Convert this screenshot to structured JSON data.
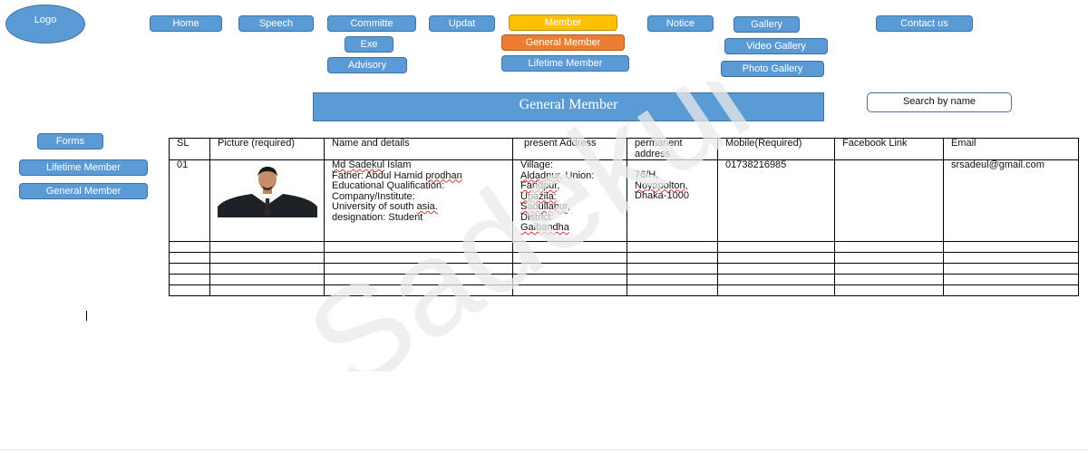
{
  "logo": "Logo",
  "nav": {
    "home": "Home",
    "speech": "Speech",
    "committee": "Committe",
    "exe": "Exe",
    "advisory": "Advisory",
    "update": "Updat",
    "member": "Member",
    "general_member": "General Member",
    "lifetime_member": "Lifetime Member",
    "notice": "Notice",
    "gallery": "Gallery",
    "video_gallery": "Video Gallery",
    "photo_gallery": "Photo Gallery",
    "contact": "Contact us"
  },
  "page_title": "General Member",
  "search": {
    "label": "Search by name"
  },
  "sidebar": {
    "forms": "Forms",
    "lifetime_member": "Lifetime Member",
    "general_member": "General Member"
  },
  "table": {
    "headers": {
      "sl": "SL",
      "picture": "Picture (required)",
      "name": "Name and details",
      "present": "present Address",
      "permanent": "permanent address",
      "mobile": "Mobile(Required)",
      "facebook": "Facebook Link",
      "email": "Email"
    },
    "row1": {
      "sl": "01",
      "name_line1": "Md Sadekul Islam",
      "name_line2": "Father: Abdul Hamid prodhan",
      "name_line3": "Educational Qualification:",
      "name_line4": "Company/Institute:",
      "name_line5": "University of south asia.",
      "name_line6": "designation: Student",
      "present_line1": "Village:",
      "present_line2": "Aldadpur, Union:",
      "present_line3": "Faridpur,",
      "present_line4": "Upazila:",
      "present_line5": "Sadullapur,",
      "present_line6": "District:",
      "present_line7": "Gaibandha",
      "permanent_line1": "76/H,",
      "permanent_line2": "Noyapolton,",
      "permanent_line3": "Dhaka-1000",
      "mobile": "01738216985",
      "facebook": "",
      "email": "srsadeul@gmail.com"
    }
  },
  "watermark": "Sadekul",
  "colors": {
    "button_blue": "#5b9bd5",
    "member_yellow": "#ffc000",
    "general_orange": "#ed7d31"
  }
}
